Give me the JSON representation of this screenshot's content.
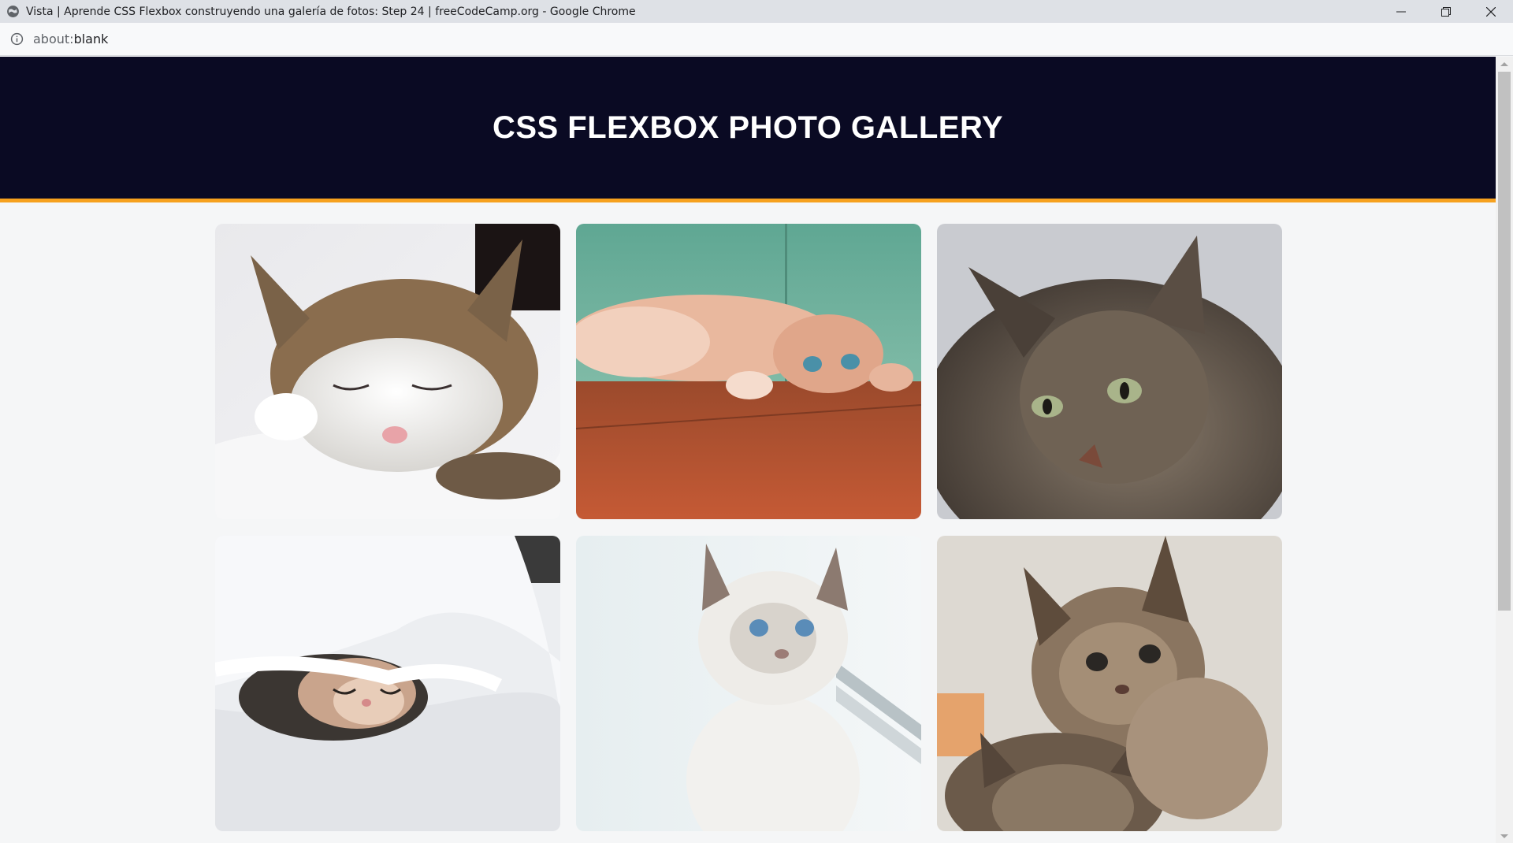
{
  "browser": {
    "window_title": "Vista | Aprende CSS Flexbox construyendo una galería de fotos: Step 24 | freeCodeCamp.org - Google Chrome",
    "url_scheme": "about:",
    "url_path": "blank"
  },
  "page": {
    "heading": "CSS FLEXBOX PHOTO GALLERY",
    "header_bg": "#0a0a23",
    "header_border": "#f6a11e"
  },
  "gallery": {
    "photos": [
      {
        "name": "cat-photo-1",
        "subject": "sleeping tabby-white cat on bedsheet"
      },
      {
        "name": "cat-photo-2",
        "subject": "ginger kitten lying on wooden floor"
      },
      {
        "name": "cat-photo-3",
        "subject": "grey tabby long-haired cat"
      },
      {
        "name": "cat-photo-4",
        "subject": "kitten sleeping under white duvet"
      },
      {
        "name": "cat-photo-5",
        "subject": "white kitten with blue eyes"
      },
      {
        "name": "cat-photo-6",
        "subject": "two tabby kittens"
      }
    ]
  },
  "icons": {
    "globe": "globe-icon",
    "info": "info-icon",
    "minimize": "minimize-icon",
    "restore": "restore-icon",
    "close": "close-icon"
  }
}
